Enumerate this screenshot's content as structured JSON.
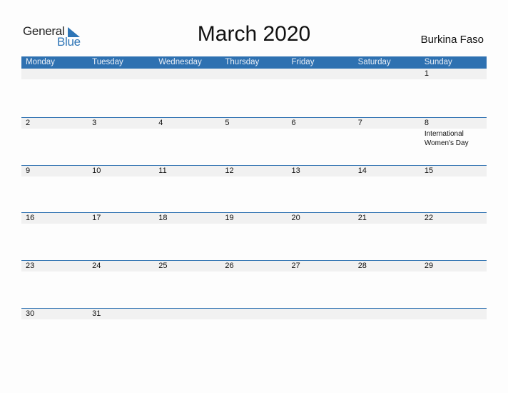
{
  "logo": {
    "general": "General",
    "blue": "Blue"
  },
  "title": "March 2020",
  "country": "Burkina Faso",
  "weekdays": [
    "Monday",
    "Tuesday",
    "Wednesday",
    "Thursday",
    "Friday",
    "Saturday",
    "Sunday"
  ],
  "weeks": [
    [
      {
        "day": ""
      },
      {
        "day": ""
      },
      {
        "day": ""
      },
      {
        "day": ""
      },
      {
        "day": ""
      },
      {
        "day": ""
      },
      {
        "day": "1"
      }
    ],
    [
      {
        "day": "2"
      },
      {
        "day": "3"
      },
      {
        "day": "4"
      },
      {
        "day": "5"
      },
      {
        "day": "6"
      },
      {
        "day": "7"
      },
      {
        "day": "8",
        "event": "International Women's Day"
      }
    ],
    [
      {
        "day": "9"
      },
      {
        "day": "10"
      },
      {
        "day": "11"
      },
      {
        "day": "12"
      },
      {
        "day": "13"
      },
      {
        "day": "14"
      },
      {
        "day": "15"
      }
    ],
    [
      {
        "day": "16"
      },
      {
        "day": "17"
      },
      {
        "day": "18"
      },
      {
        "day": "19"
      },
      {
        "day": "20"
      },
      {
        "day": "21"
      },
      {
        "day": "22"
      }
    ],
    [
      {
        "day": "23"
      },
      {
        "day": "24"
      },
      {
        "day": "25"
      },
      {
        "day": "26"
      },
      {
        "day": "27"
      },
      {
        "day": "28"
      },
      {
        "day": "29"
      }
    ],
    [
      {
        "day": "30"
      },
      {
        "day": "31"
      },
      {
        "day": ""
      },
      {
        "day": ""
      },
      {
        "day": ""
      },
      {
        "day": ""
      },
      {
        "day": ""
      }
    ]
  ],
  "colors": {
    "accent": "#2e71b1",
    "band": "#f1f1f1"
  }
}
